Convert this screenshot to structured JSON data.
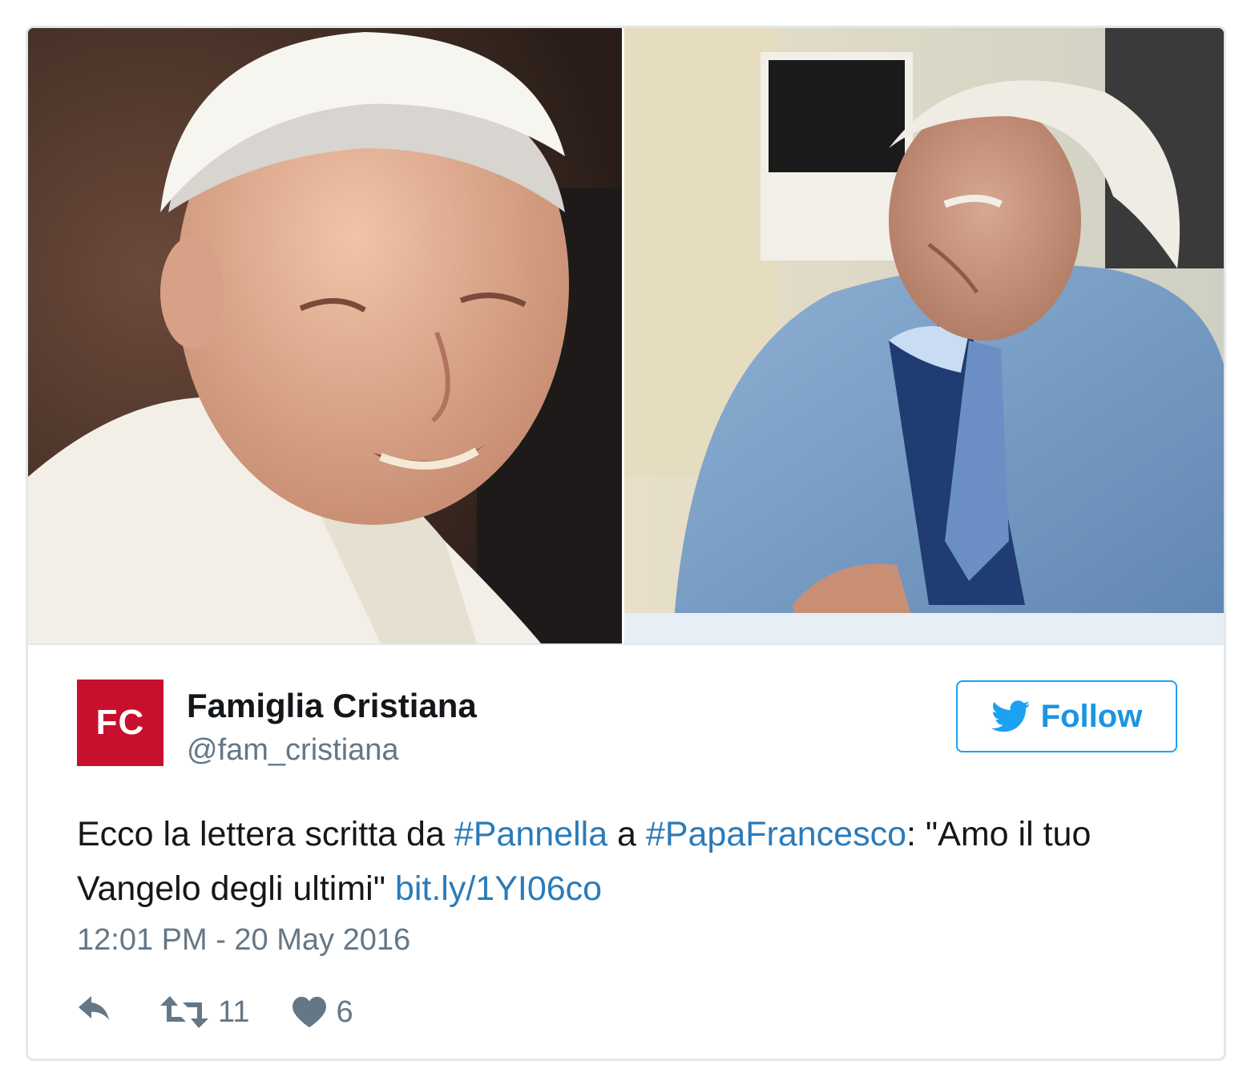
{
  "media": {
    "photos": [
      "pope-portrait",
      "man-in-blue-suit-portrait"
    ]
  },
  "author": {
    "avatar_text": "FC",
    "name": "Famiglia Cristiana",
    "handle": "@fam_cristiana",
    "brand_color": "#c8102e"
  },
  "follow_button": {
    "label": "Follow",
    "icon": "twitter-bird-icon",
    "color": "#1da1f2"
  },
  "tweet": {
    "text_1": "Ecco la lettera scritta da ",
    "hashtag_1": "#Pannella",
    "text_2": " a ",
    "hashtag_2": "#PapaFrancesco",
    "text_3": ": \"Amo il tuo Vangelo degli ultimi\" ",
    "link": "bit.ly/1YI06co",
    "link_color": "#2b7bb9"
  },
  "timestamp": "12:01 PM - 20 May 2016",
  "actions": {
    "reply_icon": "reply-icon",
    "retweet_icon": "retweet-icon",
    "retweet_count": "11",
    "like_icon": "heart-icon",
    "like_count": "6"
  }
}
